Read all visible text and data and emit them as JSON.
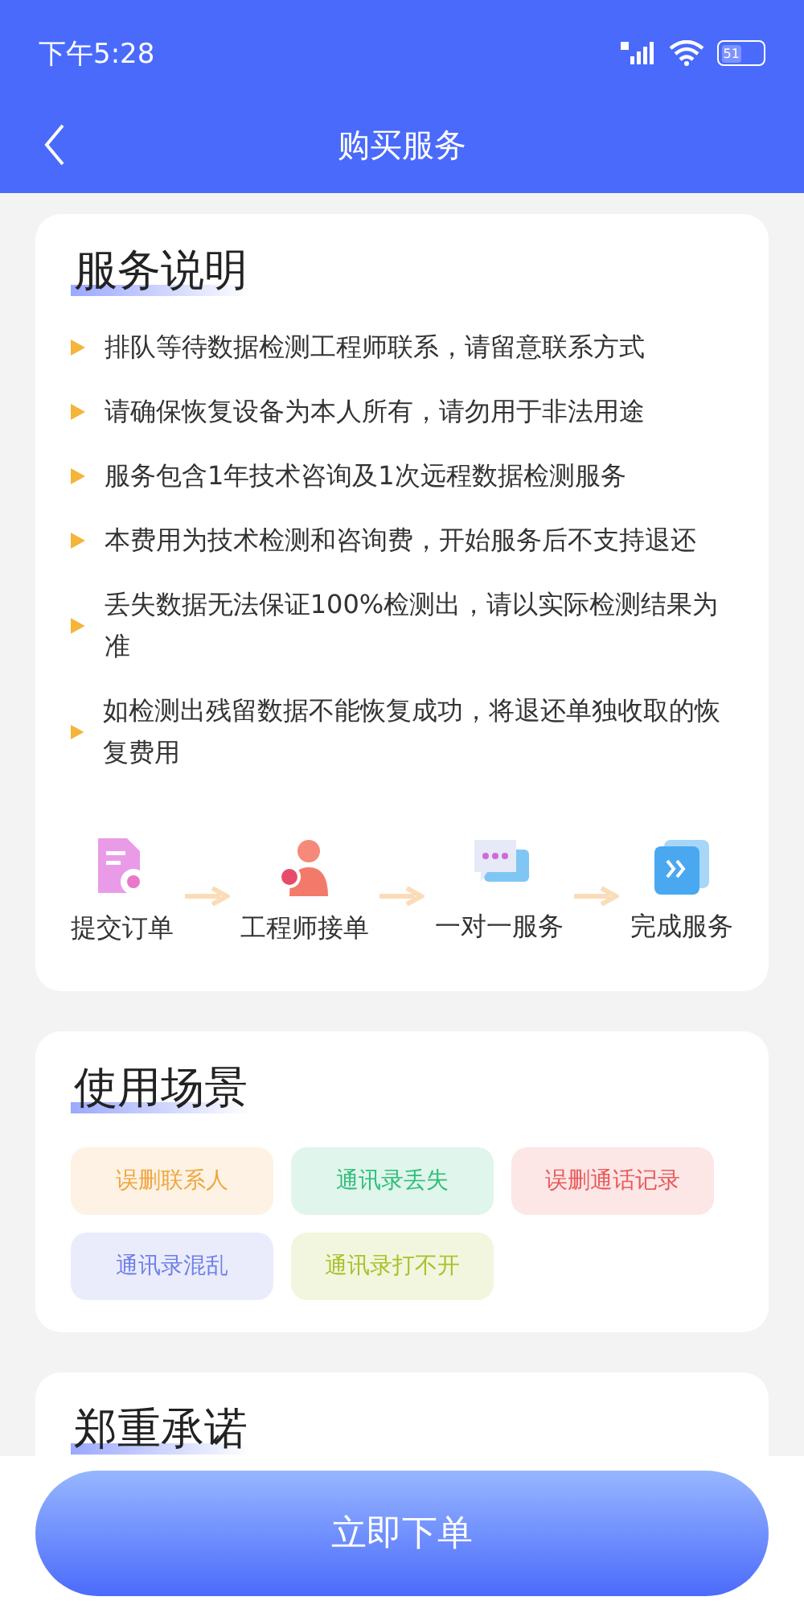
{
  "status_bar": {
    "time": "下午5:28",
    "battery": "51"
  },
  "nav": {
    "title": "购买服务"
  },
  "service_card": {
    "title": "服务说明",
    "items": [
      "排队等待数据检测工程师联系，请留意联系方式",
      "请确保恢复设备为本人所有，请勿用于非法用途",
      "服务包含1年技术咨询及1次远程数据检测服务",
      "本费用为技术检测和咨询费，开始服务后不支持退还",
      "丢失数据无法保证100%检测出，请以实际检测结果为准",
      "如检测出残留数据不能恢复成功，将退还单独收取的恢复费用"
    ],
    "steps": [
      {
        "kind": "order",
        "label": "提交订单"
      },
      {
        "kind": "engineer",
        "label": "工程师接单"
      },
      {
        "kind": "chat",
        "label": "一对一服务"
      },
      {
        "kind": "done",
        "label": "完成服务"
      }
    ]
  },
  "scenes_card": {
    "title": "使用场景",
    "tags": [
      {
        "label": "误删联系人",
        "color": "#f0a640"
      },
      {
        "label": "通讯录丢失",
        "color": "#2fbf7a"
      },
      {
        "label": "误删通话记录",
        "color": "#e85a5a"
      },
      {
        "label": "通讯录混乱",
        "color": "#6f7fe8"
      },
      {
        "label": "通讯录打不开",
        "color": "#a8c22a"
      }
    ]
  },
  "promise_card": {
    "title": "郑重承诺"
  },
  "order_button": "立即下单"
}
